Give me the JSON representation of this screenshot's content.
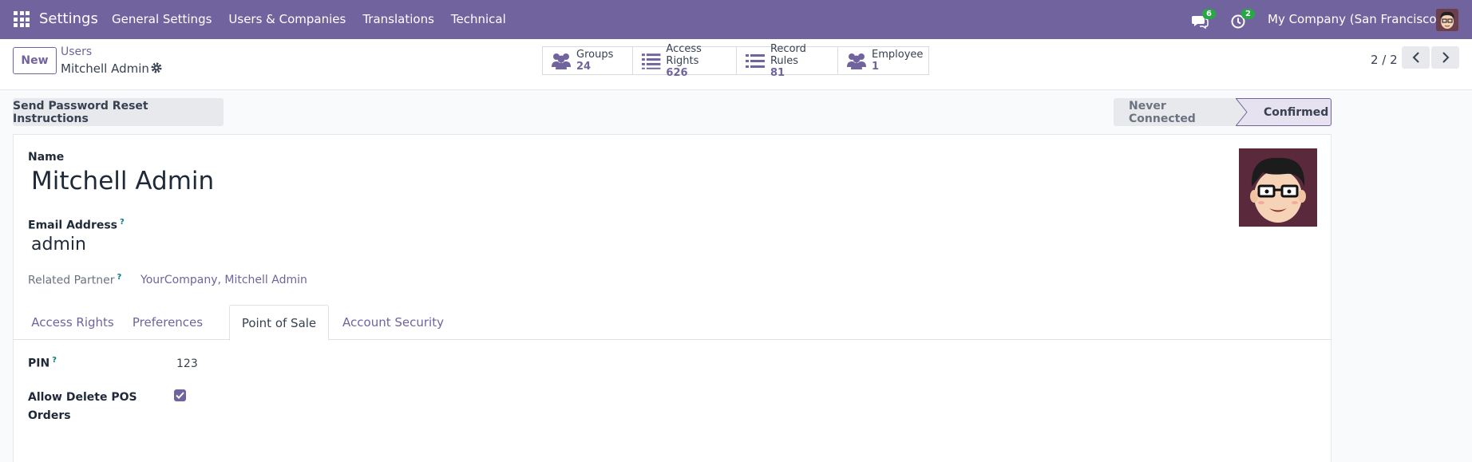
{
  "topbar": {
    "app_name": "Settings",
    "menu": [
      "General Settings",
      "Users & Companies",
      "Translations",
      "Technical"
    ],
    "messages_count": "6",
    "activities_count": "2",
    "company": "My Company (San Francisco)"
  },
  "control": {
    "new_label": "New",
    "breadcrumb_parent": "Users",
    "breadcrumb_current": "Mitchell Admin",
    "smart_buttons": [
      {
        "label": "Groups",
        "value": "24",
        "icon": "users-icon"
      },
      {
        "label": "Access Rights",
        "value": "626",
        "icon": "list-icon"
      },
      {
        "label": "Record Rules",
        "value": "81",
        "icon": "list-icon"
      },
      {
        "label": "Employee",
        "value": "1",
        "icon": "users-icon"
      }
    ],
    "pager": "2 / 2"
  },
  "status": {
    "reset_button": "Send Password Reset Instructions",
    "stages": [
      "Never Connected",
      "Confirmed"
    ],
    "active_stage": "Confirmed"
  },
  "form": {
    "name_label": "Name",
    "name_value": "Mitchell Admin",
    "email_label": "Email Address",
    "email_value": "admin",
    "help_mark": "?",
    "partner_label": "Related Partner",
    "partner_value": "YourCompany, Mitchell Admin",
    "tabs": [
      "Access Rights",
      "Preferences",
      "Point of Sale",
      "Account Security"
    ],
    "active_tab": "Point of Sale",
    "pin_label": "PIN",
    "pin_value": "123",
    "allow_delete_label_1": "Allow Delete POS",
    "allow_delete_label_2": "Orders",
    "allow_delete_checked": true
  },
  "colors": {
    "brand": "#71639e",
    "badge": "#28a745"
  }
}
